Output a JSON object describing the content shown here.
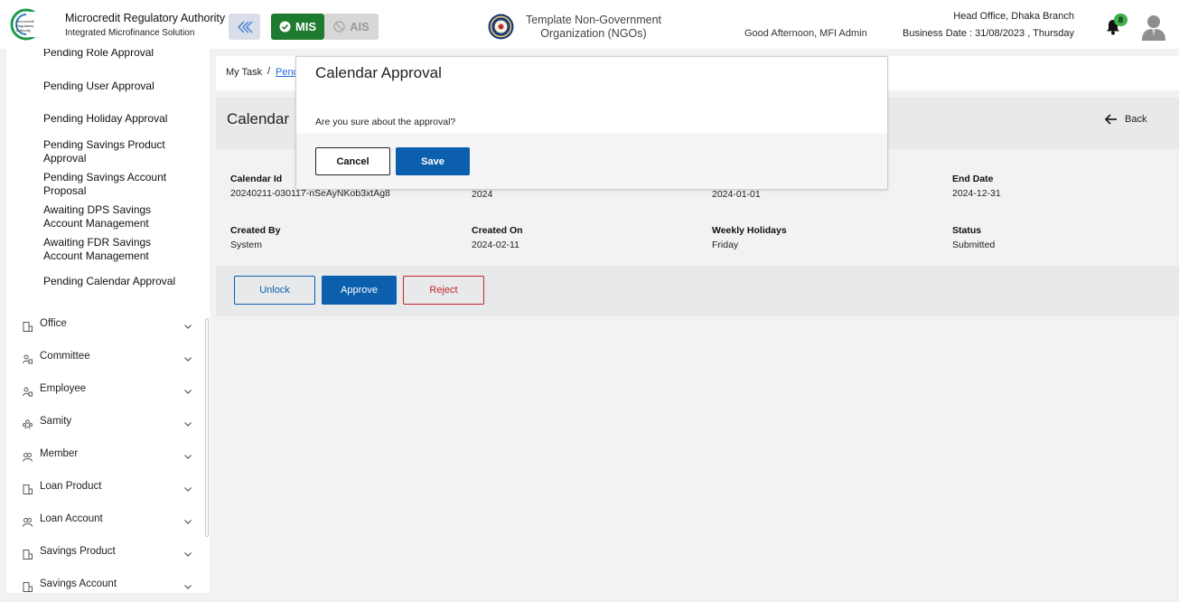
{
  "header": {
    "org_title": "Microcredit Regulatory Authority",
    "org_subtitle": "Integrated Microfinance Solution",
    "logo_text": "Microcredit Regulatory Authority",
    "mis_label": "MIS",
    "ais_label": "AIS",
    "ngo_line1": "Template Non-Government",
    "ngo_line2": "Organization (NGOs)",
    "greeting": "Good Afternoon, MFI Admin",
    "branch": "Head Office, Dhaka Branch",
    "business_date": "Business Date : 31/08/2023 , Thursday",
    "notification_count": "8",
    "colors": {
      "mis": "#1e7a2e",
      "primary": "#0b5fad",
      "danger": "#c3262b"
    }
  },
  "sidebar": {
    "sub_items": [
      "Pending Role Approval",
      "Pending User Approval",
      "Pending Holiday Approval",
      "Pending Savings Product Approval",
      "Pending Savings Account Proposal",
      "Awaiting DPS Savings Account Management",
      "Awaiting FDR Savings Account Management",
      "Pending Calendar Approval"
    ],
    "menus": [
      {
        "label": "Office",
        "icon": "office-icon"
      },
      {
        "label": "Committee",
        "icon": "committee-icon"
      },
      {
        "label": "Employee",
        "icon": "employee-icon"
      },
      {
        "label": "Samity",
        "icon": "samity-icon"
      },
      {
        "label": "Member",
        "icon": "member-icon"
      },
      {
        "label": "Loan Product",
        "icon": "loan-product-icon"
      },
      {
        "label": "Loan Account",
        "icon": "loan-account-icon"
      },
      {
        "label": "Savings Product",
        "icon": "savings-product-icon"
      },
      {
        "label": "Savings Account",
        "icon": "savings-account-icon"
      }
    ]
  },
  "breadcrumb": {
    "root": "My Task",
    "sep": "/",
    "current": "Pend"
  },
  "page": {
    "title": "Calendar",
    "back_label": "Back"
  },
  "details": {
    "calendar_id_label": "Calendar Id",
    "calendar_id": "20240211-030117-nSeAyNKob3xtAg8",
    "year": "2024",
    "start_date": "2024-01-01",
    "end_date_label": "End Date",
    "end_date": "2024-12-31",
    "created_by_label": "Created By",
    "created_by": "System",
    "created_on_label": "Created On",
    "created_on": "2024-02-11",
    "weekly_holidays_label": "Weekly Holidays",
    "weekly_holidays": "Friday",
    "status_label": "Status",
    "status": "Submitted"
  },
  "actions": {
    "unlock": "Unlock",
    "approve": "Approve",
    "reject": "Reject"
  },
  "modal": {
    "title": "Calendar Approval",
    "message": "Are you sure about the approval?",
    "cancel": "Cancel",
    "save": "Save"
  }
}
